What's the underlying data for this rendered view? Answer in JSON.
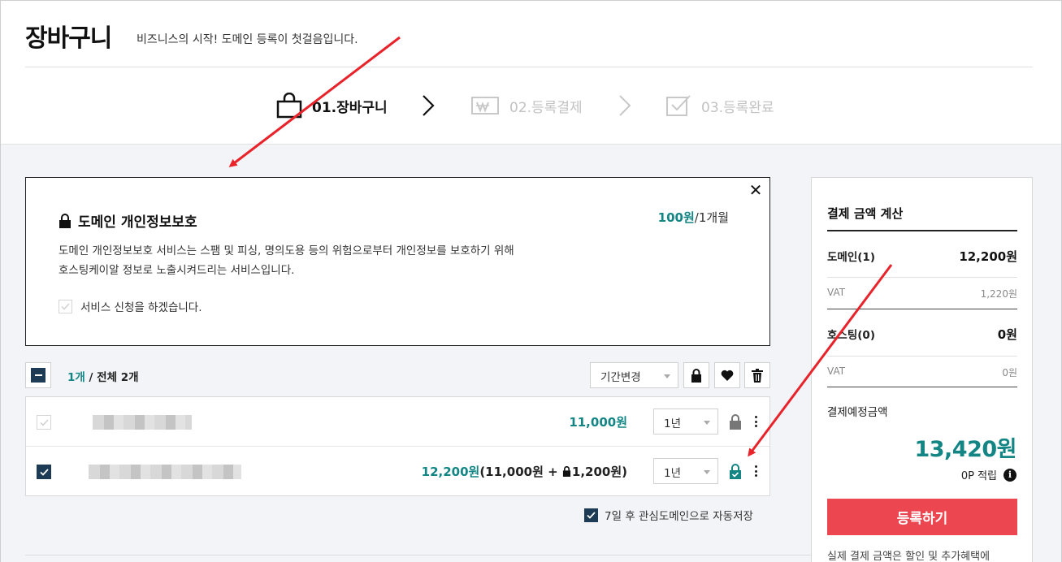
{
  "header": {
    "title": "장바구니",
    "subtitle": "비즈니스의 시작! 도메인 등록이 첫걸음입니다."
  },
  "steps": [
    {
      "label": "01.장바구니",
      "active": true
    },
    {
      "label": "02.등록결제",
      "active": false
    },
    {
      "label": "03.등록완료",
      "active": false
    }
  ],
  "privacy": {
    "title": "도메인 개인정보보호",
    "price_value": "100원",
    "price_unit": "/1개월",
    "desc_line1": "도메인 개인정보보호 서비스는 스팸 및 피싱, 명의도용 등의 위험으로부터 개인정보를 보호하기 위해",
    "desc_line2": "호스팅케이알 정보로 노출시켜드리는 서비스입니다.",
    "checkbox_label": "서비스 신청을 하겠습니다.",
    "checked": false
  },
  "list": {
    "selected_count": "1개",
    "total_label": " / 전체 2개",
    "period_select": "기간변경"
  },
  "rows": [
    {
      "checked": false,
      "price": "11,000원",
      "period": "1년",
      "privacy_locked": false
    },
    {
      "checked": true,
      "price_main": "12,200원",
      "price_detail_open": "(11,000원 + ",
      "price_detail_privacy": "1,200원)",
      "period": "1년",
      "privacy_locked": true
    }
  ],
  "autosave": {
    "label": "7일 후 관심도메인으로 자동저장",
    "checked": true
  },
  "summary": {
    "title": "결제 금액 계산",
    "domain_label": "도메인(1)",
    "domain_value": "12,200원",
    "domain_vat_label": "VAT",
    "domain_vat_value": "1,220원",
    "hosting_label": "호스팅(0)",
    "hosting_value": "0원",
    "hosting_vat_label": "VAT",
    "hosting_vat_value": "0원",
    "pay_label": "결제예정금액",
    "total": "13,420원",
    "points": "0P 적립",
    "register_button": "등록하기",
    "note": "실제 결제 금액은 할인 및 추가혜택에"
  },
  "colors": {
    "accent": "#138585",
    "navy": "#1d3b55",
    "register": "#ec4650",
    "annotation_arrow": "#e8232a"
  },
  "icons": [
    "shopping-bag-icon",
    "chevron-right-icon",
    "payment-won-icon",
    "check-box-icon",
    "lock-icon",
    "close-icon",
    "heart-icon",
    "trash-icon",
    "more-vertical-icon",
    "info-icon"
  ]
}
